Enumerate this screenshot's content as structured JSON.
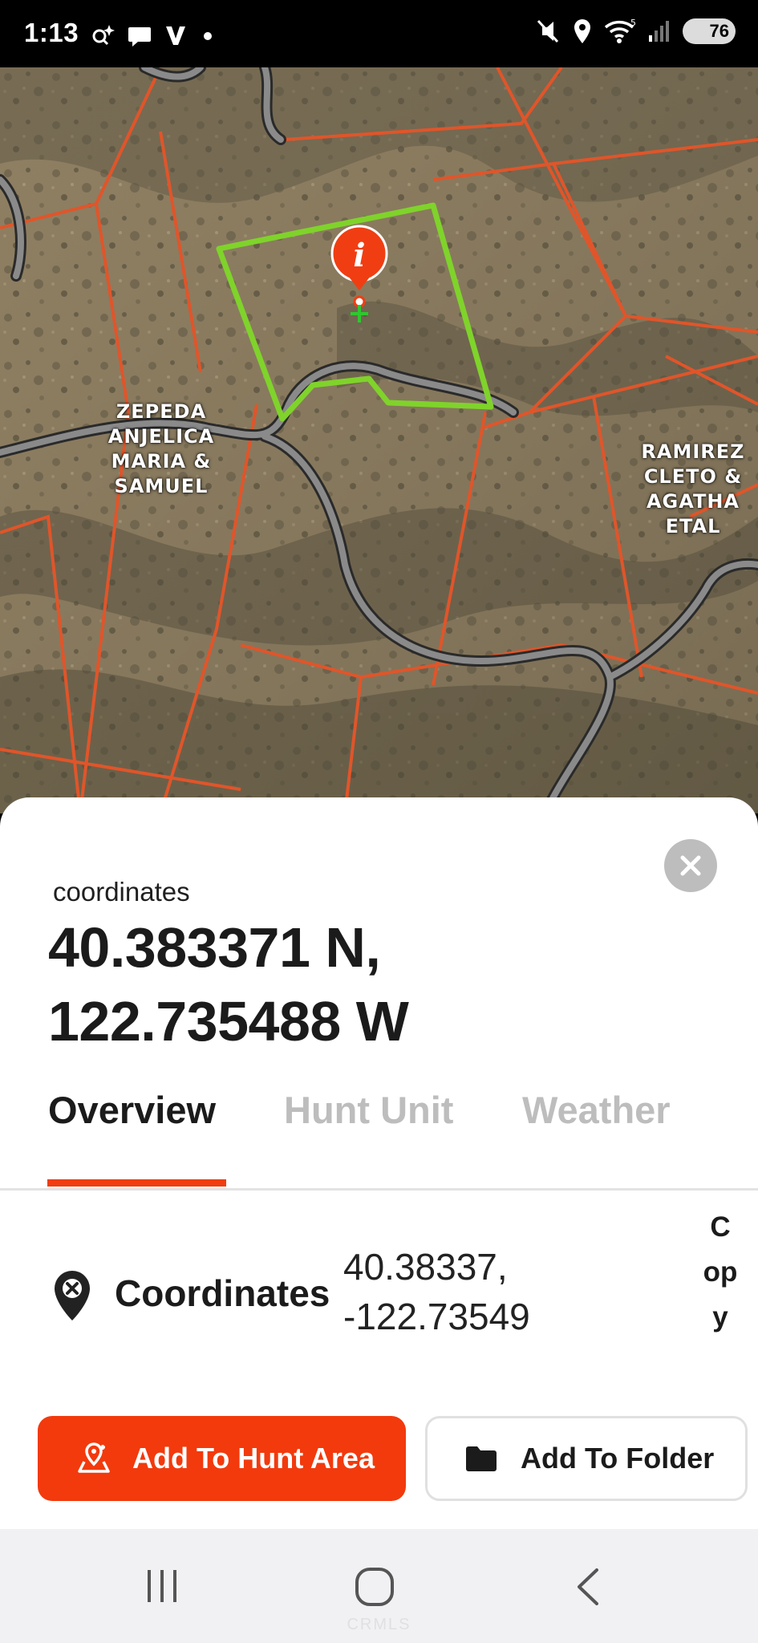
{
  "status_bar": {
    "time": "1:13",
    "battery": "76",
    "left_icons": [
      "assistant-sparkle-icon",
      "chat-icon",
      "v-app-icon",
      "dot-icon"
    ],
    "right_icons": [
      "mute-icon",
      "location-icon",
      "wifi-icon",
      "signal-icon"
    ]
  },
  "map": {
    "labels": [
      {
        "id": "zepeda",
        "text": "ZEPEDA\nANJELICA\nMARIA &\nSAMUEL"
      },
      {
        "id": "ramirez",
        "text": "RAMIREZ\nCLETO &\nAGATHA\nETAL"
      }
    ],
    "marker": "i",
    "colors": {
      "parcel_lines": "#e0552a",
      "selected_parcel": "#7fd32a",
      "road": "#7a7a7a",
      "marker": "#f03e12"
    }
  },
  "sheet": {
    "caption": "coordinates",
    "title_line1": "40.383371 N,",
    "title_line2": "122.735488 W",
    "close_icon": "close-icon",
    "tabs": [
      {
        "label": "Overview",
        "active": true
      },
      {
        "label": "Hunt Unit",
        "active": false
      },
      {
        "label": "Weather",
        "active": false
      }
    ],
    "coordinates_row": {
      "label": "Coordinates",
      "lat": "40.38337,",
      "lon": "-122.73549",
      "copy_label": "Copy"
    },
    "buttons": {
      "add_hunt_area": "Add To Hunt Area",
      "add_folder": "Add To Folder"
    },
    "accent_color": "#f23a0d"
  },
  "nav_bar": {
    "icons": [
      "recent-apps-icon",
      "home-icon",
      "back-icon"
    ]
  },
  "watermark": "CRMLS"
}
